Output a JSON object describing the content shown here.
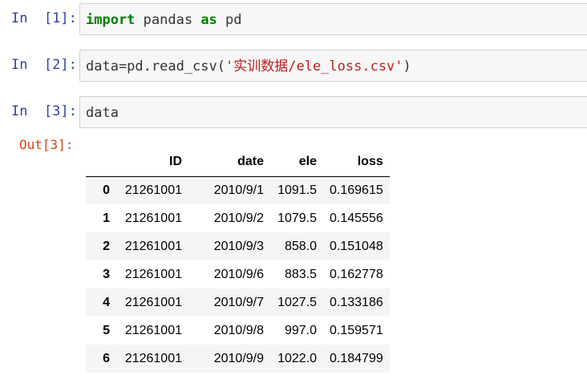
{
  "cells": [
    {
      "prompt": "In  [1]:",
      "code": {
        "kw1": "import",
        "mid": " pandas ",
        "kw2": "as",
        "tail": " pd"
      }
    },
    {
      "prompt": "In  [2]:",
      "code": {
        "pre": "data=pd.read_csv(",
        "str": "'实训数据/ele_loss.csv'",
        "post": ")"
      }
    },
    {
      "prompt": "In  [3]:",
      "code": {
        "text": "data"
      }
    }
  ],
  "output": {
    "prompt": "Out[3]:",
    "table": {
      "columns": [
        "",
        "ID",
        "date",
        "ele",
        "loss"
      ],
      "rows": [
        [
          "0",
          "21261001",
          "2010/9/1",
          "1091.5",
          "0.169615"
        ],
        [
          "1",
          "21261001",
          "2010/9/2",
          "1079.5",
          "0.145556"
        ],
        [
          "2",
          "21261001",
          "2010/9/3",
          "858.0",
          "0.151048"
        ],
        [
          "3",
          "21261001",
          "2010/9/6",
          "883.5",
          "0.162778"
        ],
        [
          "4",
          "21261001",
          "2010/9/7",
          "1027.5",
          "0.133186"
        ],
        [
          "5",
          "21261001",
          "2010/9/8",
          "997.0",
          "0.159571"
        ],
        [
          "6",
          "21261001",
          "2010/9/9",
          "1022.0",
          "0.184799"
        ]
      ]
    }
  },
  "colors": {
    "in_prompt": "#303f9f",
    "out_prompt": "#d84315",
    "keyword": "#008000",
    "string": "#ba2121",
    "cell_bg": "#f7f7f7",
    "cell_border": "#cfcfcf",
    "row_stripe": "#f5f5f5"
  }
}
